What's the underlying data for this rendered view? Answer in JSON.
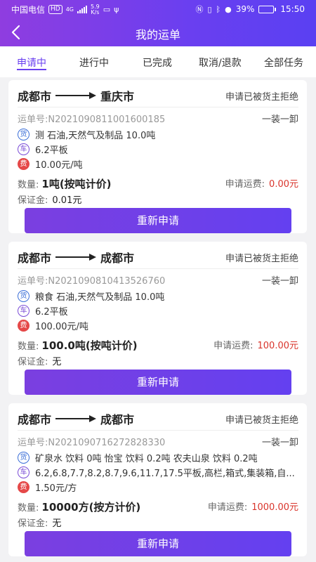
{
  "statusbar": {
    "carrier": "中国电信",
    "hd": "HD",
    "net": "4G",
    "speed_value": "5.9",
    "speed_unit": "K/s",
    "battery": "39%",
    "battery_level": 0.39,
    "time": "15:50"
  },
  "nav": {
    "title": "我的运单"
  },
  "tabs": [
    {
      "label": "申请中",
      "active": true
    },
    {
      "label": "进行中",
      "active": false
    },
    {
      "label": "已完成",
      "active": false
    },
    {
      "label": "取消/退款",
      "active": false
    },
    {
      "label": "全部任务",
      "active": false
    }
  ],
  "labels": {
    "goods_badge": "货",
    "car_badge": "车",
    "fee_badge": "费",
    "qty_prefix": "数量:",
    "fee_prefix": "申请运费:",
    "deposit_prefix": "保证金:",
    "button": "重新申请"
  },
  "orders": [
    {
      "from": "成都市",
      "to": "重庆市",
      "status": "申请已被货主拒绝",
      "waybill": "运单号:N2021090811001600185",
      "mode": "一装一卸",
      "goods": "测 石油,天然气及制品 10.0吨",
      "vehicle": "6.2平板",
      "price": "10.00元/吨",
      "quantity": "1吨(按吨计价)",
      "fee": "0.00元",
      "deposit": "0.01元"
    },
    {
      "from": "成都市",
      "to": "成都市",
      "status": "申请已被货主拒绝",
      "waybill": "运单号:N2021090810413526760",
      "mode": "一装一卸",
      "goods": "粮食 石油,天然气及制品 10.0吨",
      "vehicle": "6.2平板",
      "price": "100.00元/吨",
      "quantity": "100.0吨(按吨计价)",
      "fee": "100.00元",
      "deposit": "无"
    },
    {
      "from": "成都市",
      "to": "成都市",
      "status": "申请已被货主拒绝",
      "waybill": "运单号:N2021090716272828330",
      "mode": "一装一卸",
      "goods": "矿泉水 饮料 0吨 怡宝 饮料 0.2吨  农夫山泉  饮料 0.2吨",
      "vehicle": "6.2,6.8,7.7,8.2,8.7,9.6,11.7,17.5平板,高栏,箱式,集装箱,自...",
      "price": "1.50元/方",
      "quantity": "10000方(按方计价)",
      "fee": "1000.00元",
      "deposit": "无"
    }
  ]
}
